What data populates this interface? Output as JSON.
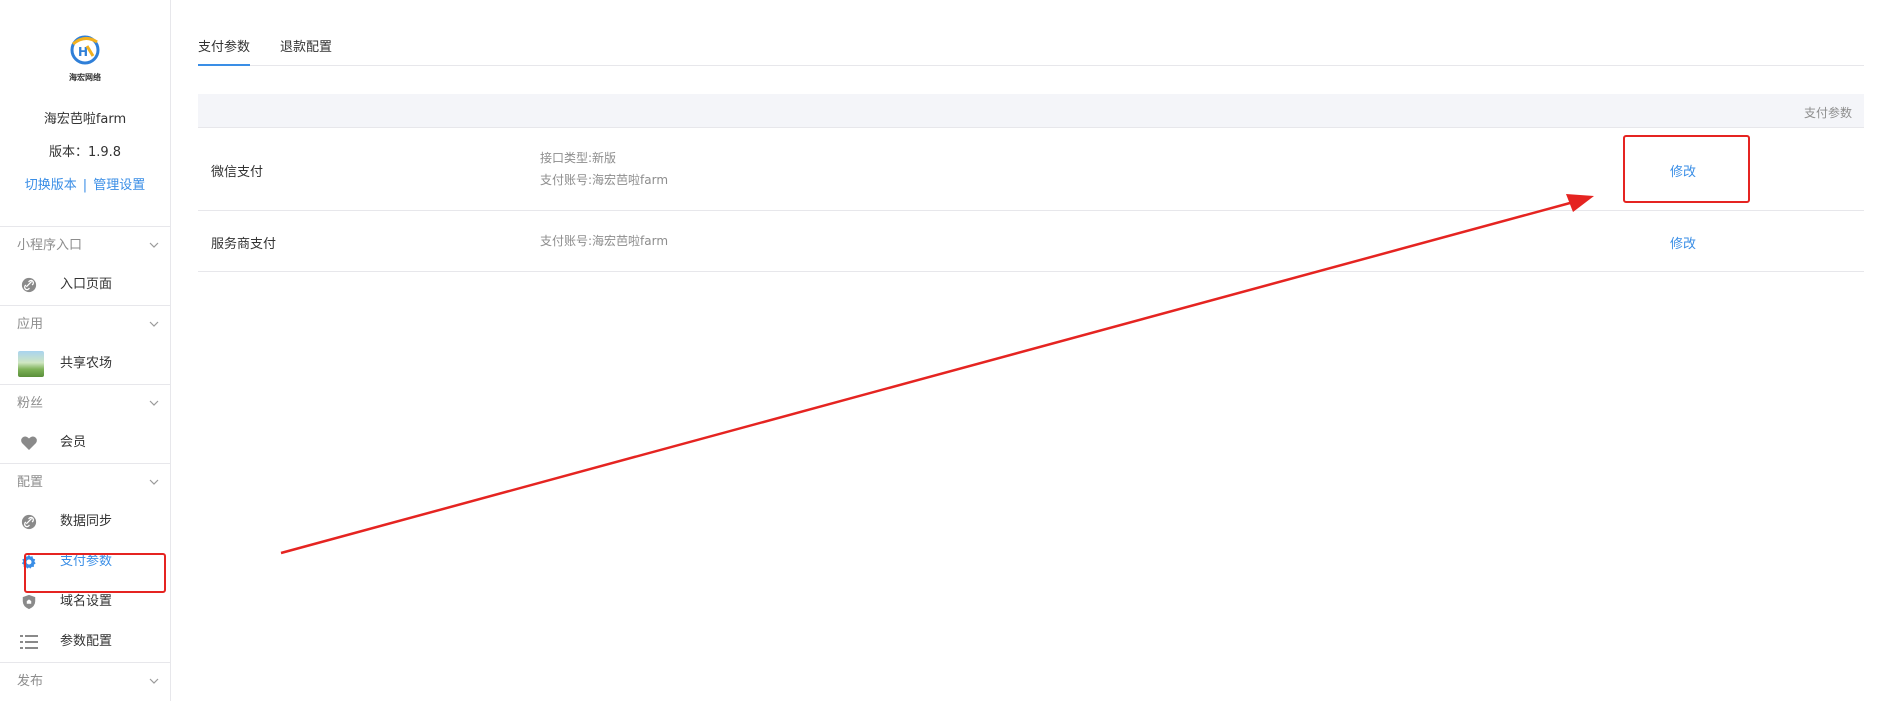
{
  "brand": {
    "logo_text": "海宏网络",
    "app_name": "海宏芭啦farm",
    "version": "版本：1.9.8",
    "switch_version": "切换版本",
    "separator": "|",
    "manage_settings": "管理设置"
  },
  "sidebar": {
    "groups": [
      {
        "title": "小程序入口",
        "items": [
          {
            "label": "入口页面",
            "icon": "link-icon"
          }
        ]
      },
      {
        "title": "应用",
        "items": [
          {
            "label": "共享农场",
            "icon": "farm-thumbnail"
          }
        ]
      },
      {
        "title": "粉丝",
        "items": [
          {
            "label": "会员",
            "icon": "heart-icon"
          }
        ]
      },
      {
        "title": "配置",
        "items": [
          {
            "label": "数据同步",
            "icon": "link-icon"
          },
          {
            "label": "支付参数",
            "icon": "gear-icon",
            "active": true
          },
          {
            "label": "域名设置",
            "icon": "shield-icon"
          },
          {
            "label": "参数配置",
            "icon": "list-icon"
          }
        ]
      },
      {
        "title": "发布",
        "items": []
      }
    ]
  },
  "tabs": [
    {
      "label": "支付参数",
      "active": true
    },
    {
      "label": "退款配置",
      "active": false
    }
  ],
  "table": {
    "header": "支付参数",
    "rows": [
      {
        "name": "微信支付",
        "info": [
          "接口类型:新版",
          "支付账号:海宏芭啦farm"
        ],
        "action": "修改"
      },
      {
        "name": "服务商支付",
        "info": [
          "支付账号:海宏芭啦farm"
        ],
        "action": "修改"
      }
    ]
  },
  "colors": {
    "accent": "#3a8ee6",
    "annotation": "#e52421",
    "muted_text": "#8d8d8d",
    "border": "#e7e7eb",
    "header_bg": "#f4f5f9"
  }
}
